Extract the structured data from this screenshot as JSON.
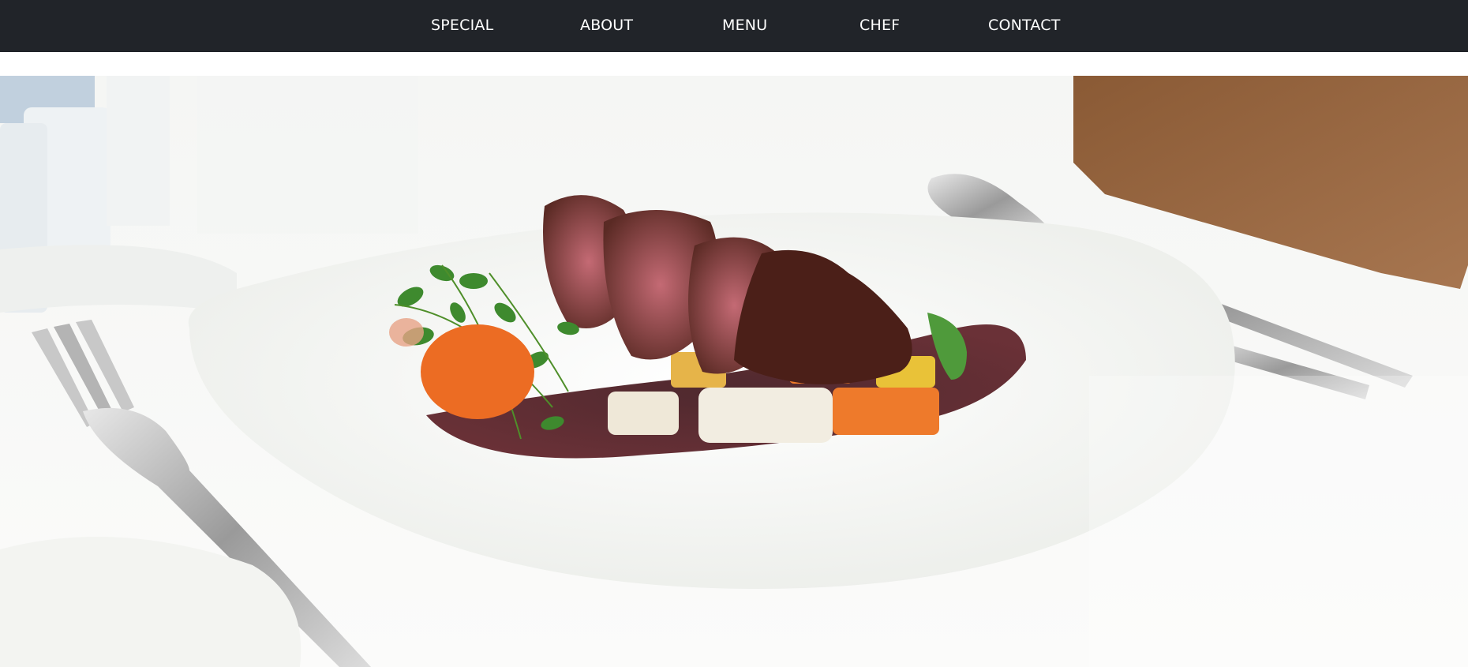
{
  "nav": {
    "items": [
      {
        "label": "SPECIAL"
      },
      {
        "label": "ABOUT"
      },
      {
        "label": "MENU"
      },
      {
        "label": "CHEF"
      },
      {
        "label": "CONTACT"
      }
    ]
  },
  "hero": {
    "image": "plated-steak-dish-photo"
  },
  "colors": {
    "navbar_bg": "#212429",
    "nav_text": "#ffffff",
    "page_bg": "#ffffff"
  }
}
